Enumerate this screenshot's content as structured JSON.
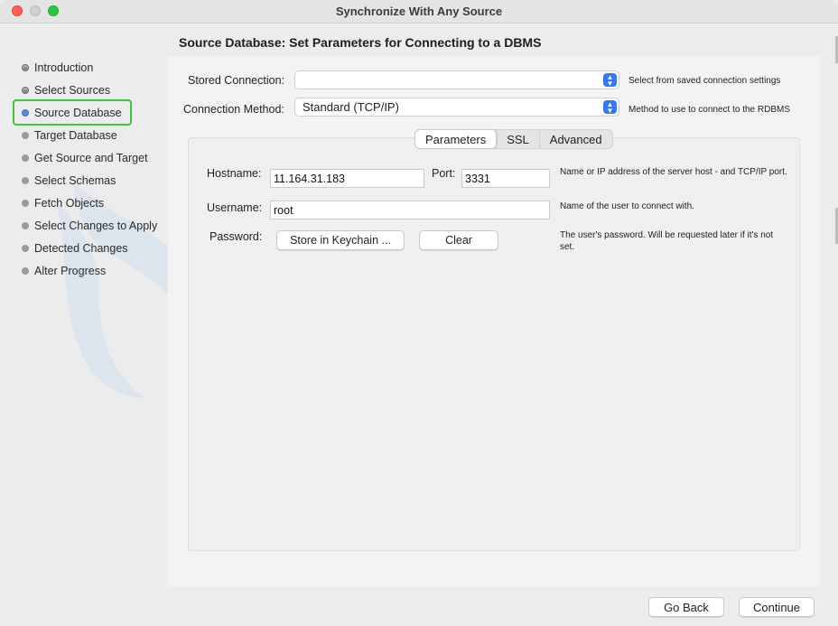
{
  "window": {
    "title": "Synchronize With Any Source"
  },
  "page": {
    "heading": "Source Database: Set Parameters for Connecting to a DBMS"
  },
  "nav": {
    "items": [
      {
        "label": "Introduction",
        "state": "done"
      },
      {
        "label": "Select Sources",
        "state": "done"
      },
      {
        "label": "Source Database",
        "state": "current"
      },
      {
        "label": "Target Database",
        "state": "todo"
      },
      {
        "label": "Get Source and Target",
        "state": "todo"
      },
      {
        "label": "Select Schemas",
        "state": "todo"
      },
      {
        "label": "Fetch Objects",
        "state": "todo"
      },
      {
        "label": "Select Changes to Apply",
        "state": "todo"
      },
      {
        "label": "Detected Changes",
        "state": "todo"
      },
      {
        "label": "Alter Progress",
        "state": "todo"
      }
    ]
  },
  "connection": {
    "stored_label": "Stored Connection:",
    "stored_value": "",
    "stored_hint": "Select from saved connection settings",
    "method_label": "Connection Method:",
    "method_value": "Standard (TCP/IP)",
    "method_hint": "Method to use to connect to the RDBMS"
  },
  "tabs": {
    "items": [
      "Parameters",
      "SSL",
      "Advanced"
    ],
    "selected": "Parameters"
  },
  "params": {
    "hostname_label": "Hostname:",
    "hostname_value": "11.164.31.183",
    "port_label": "Port:",
    "port_value": "3331",
    "host_hint": "Name or IP address of the server host - and TCP/IP port.",
    "username_label": "Username:",
    "username_value": "root",
    "username_hint": "Name of the user to connect with.",
    "password_label": "Password:",
    "store_keychain_label": "Store in Keychain ...",
    "clear_label": "Clear",
    "password_hint": "The user's password. Will be requested later if it's not set."
  },
  "footer": {
    "back_label": "Go Back",
    "continue_label": "Continue"
  },
  "colors": {
    "accent": "#3478f6",
    "highlight": "#3ec43e",
    "close": "#fe5f57",
    "zoom": "#28c840"
  }
}
